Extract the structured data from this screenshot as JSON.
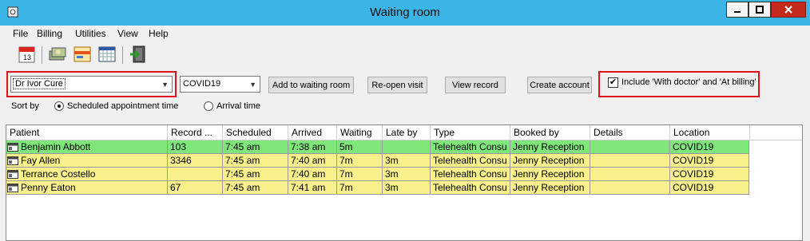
{
  "window": {
    "title": "Waiting room"
  },
  "menu": [
    "File",
    "Billing",
    "Utilities",
    "View",
    "Help"
  ],
  "toolbar_icons": [
    "calendar-icon",
    "money-icon",
    "card-icon",
    "grid-calendar-icon",
    "exit-door-icon"
  ],
  "filters": {
    "doctor": "Dr Ivor Cure",
    "location": "COVID19",
    "include_label": "Include 'With doctor' and 'At billing'",
    "include_checked": true
  },
  "buttons": {
    "add": "Add to waiting room",
    "reopen": "Re-open visit",
    "view": "View record",
    "create": "Create account"
  },
  "sort": {
    "label": "Sort by",
    "option1": "Scheduled appointment time",
    "option2": "Arrival time",
    "selected": "option1"
  },
  "table": {
    "columns": [
      "Patient",
      "Record ...",
      "Scheduled",
      "Arrived",
      "Waiting",
      "Late by",
      "Type",
      "Booked by",
      "Details",
      "Location"
    ],
    "rows": [
      {
        "patient": "Benjamin Abbott",
        "record": "103",
        "scheduled": "7:45 am",
        "arrived": "7:38 am",
        "waiting": "5m",
        "late_by": "",
        "type": "Telehealth Consu",
        "booked_by": "Jenny Reception",
        "details": "",
        "location": "COVID19",
        "color": "#7fe67a"
      },
      {
        "patient": "Fay Allen",
        "record": "3346",
        "scheduled": "7:45 am",
        "arrived": "7:40 am",
        "waiting": "7m",
        "late_by": "3m",
        "type": "Telehealth Consu",
        "booked_by": "Jenny Reception",
        "details": "",
        "location": "COVID19",
        "color": "#f8f08a"
      },
      {
        "patient": "Terrance Costello",
        "record": "",
        "scheduled": "7:45 am",
        "arrived": "7:40 am",
        "waiting": "7m",
        "late_by": "3m",
        "type": "Telehealth Consu",
        "booked_by": "Jenny Reception",
        "details": "",
        "location": "COVID19",
        "color": "#f8f08a"
      },
      {
        "patient": "Penny Eaton",
        "record": "67",
        "scheduled": "7:45 am",
        "arrived": "7:41 am",
        "waiting": "7m",
        "late_by": "3m",
        "type": "Telehealth Consu",
        "booked_by": "Jenny Reception",
        "details": "",
        "location": "COVID19",
        "color": "#f8f08a"
      }
    ]
  }
}
